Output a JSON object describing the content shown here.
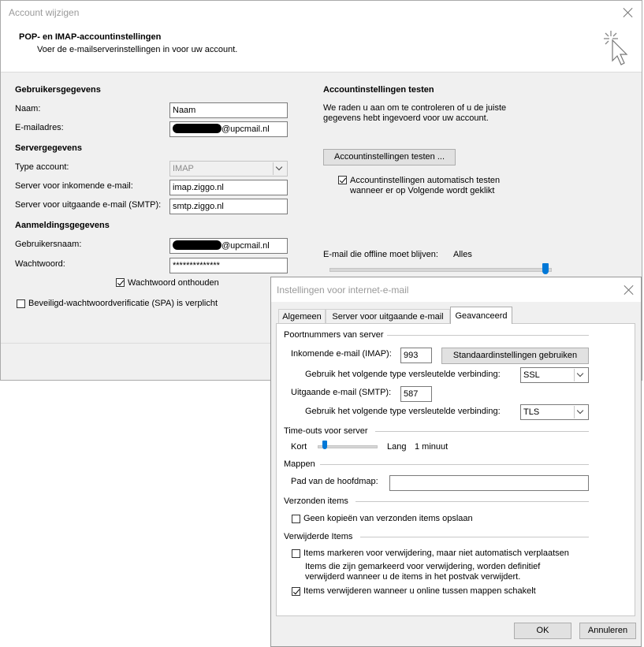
{
  "main_dialog": {
    "title": "Account wijzigen",
    "header_title": "POP- en IMAP-accountinstellingen",
    "header_subtitle": "Voer de e-mailserverinstellingen in voor uw account.",
    "user_section": "Gebruikersgegevens",
    "name_label": "Naam:",
    "name_value": "Naam",
    "email_label": "E-mailadres:",
    "email_suffix": "@upcmail.nl",
    "server_section": "Servergegevens",
    "account_type_label": "Type account:",
    "account_type_value": "IMAP",
    "incoming_label": "Server voor inkomende e-mail:",
    "incoming_value": "imap.ziggo.nl",
    "outgoing_label": "Server voor uitgaande e-mail (SMTP):",
    "outgoing_value": "smtp.ziggo.nl",
    "login_section": "Aanmeldingsgegevens",
    "username_label": "Gebruikersnaam:",
    "username_suffix": "@upcmail.nl",
    "password_label": "Wachtwoord:",
    "password_value": "**************",
    "remember_password": "Wachtwoord onthouden",
    "spa_label": "Beveiligd-wachtwoordverificatie (SPA) is verplicht",
    "test_section": "Accountinstellingen testen",
    "test_desc_1": "We raden u aan om te controleren of u de juiste",
    "test_desc_2": "gegevens hebt ingevoerd voor uw account.",
    "test_button": "Accountinstellingen testen ...",
    "auto_test_1": "Accountinstellingen automatisch testen",
    "auto_test_2": "wanneer er op Volgende wordt geklikt",
    "offline_label": "E-mail die offline moet blijven:",
    "offline_value": "Alles"
  },
  "sub_dialog": {
    "title": "Instellingen voor internet-e-mail",
    "tabs": [
      "Algemeen",
      "Server voor uitgaande e-mail",
      "Geavanceerd"
    ],
    "ports_group": "Poortnummers van server",
    "imap_label": "Inkomende e-mail (IMAP):",
    "imap_port": "993",
    "defaults_button": "Standaardinstellingen gebruiken",
    "encryption_label": "Gebruik het volgende type versleutelde verbinding:",
    "incoming_encryption": "SSL",
    "smtp_label": "Uitgaande e-mail (SMTP):",
    "smtp_port": "587",
    "outgoing_encryption": "TLS",
    "timeouts_group": "Time-outs voor server",
    "short_label": "Kort",
    "long_label": "Lang",
    "timeout_value": "1 minuut",
    "folders_group": "Mappen",
    "root_path_label": "Pad van de hoofdmap:",
    "root_path_value": "",
    "sent_group": "Verzonden items",
    "no_sent_copies": "Geen kopieën van verzonden items opslaan",
    "deleted_group": "Verwijderde Items",
    "mark_deleted": "Items markeren voor verwijdering, maar niet automatisch verplaatsen",
    "mark_note_1": "Items die zijn gemarkeerd voor verwijdering, worden definitief",
    "mark_note_2": "verwijderd wanneer u de items in het postvak verwijdert.",
    "purge_on_switch": "Items verwijderen wanneer u online tussen mappen schakelt",
    "ok_button": "OK",
    "cancel_button": "Annuleren"
  },
  "colors": {
    "dialog_bg": "#f0f0f0",
    "accent": "#0078d7"
  },
  "icons": [
    "close-icon",
    "wizard-cursor-icon",
    "chevron-down-icon"
  ],
  "state": {
    "remember_password": true,
    "spa": false,
    "auto_test": true,
    "no_sent_copies": false,
    "mark_deleted": false,
    "purge_on_switch": true,
    "offline_slider_fraction": 1.0,
    "timeout_slider_fraction": 0.1
  }
}
